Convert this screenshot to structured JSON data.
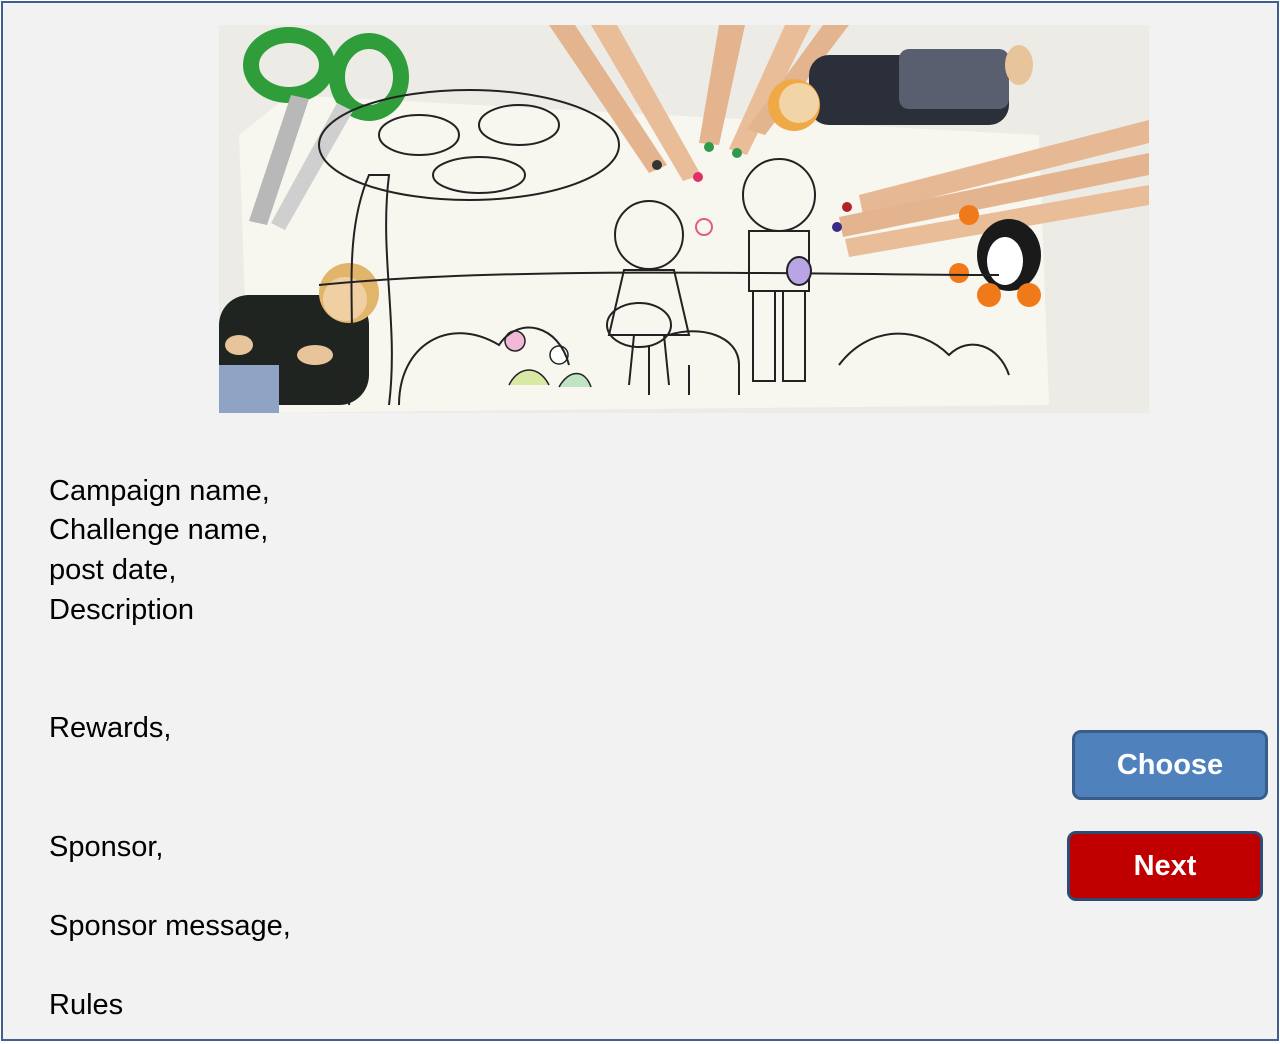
{
  "content": {
    "campaign_name_label": "Campaign name,",
    "challenge_name_label": "Challenge name,",
    "post_date_label": "post date,",
    "description_label": "Description",
    "rewards_label": "Rewards,",
    "sponsor_label": "Sponsor,",
    "sponsor_message_label": "Sponsor message,",
    "rules_label": "Rules"
  },
  "actions": {
    "choose_label": "Choose",
    "next_label": "Next"
  },
  "colors": {
    "background": "#f2f2f2",
    "frame_border": "#3f5f91",
    "choose_button": "#4f81bd",
    "next_button": "#c00000"
  }
}
